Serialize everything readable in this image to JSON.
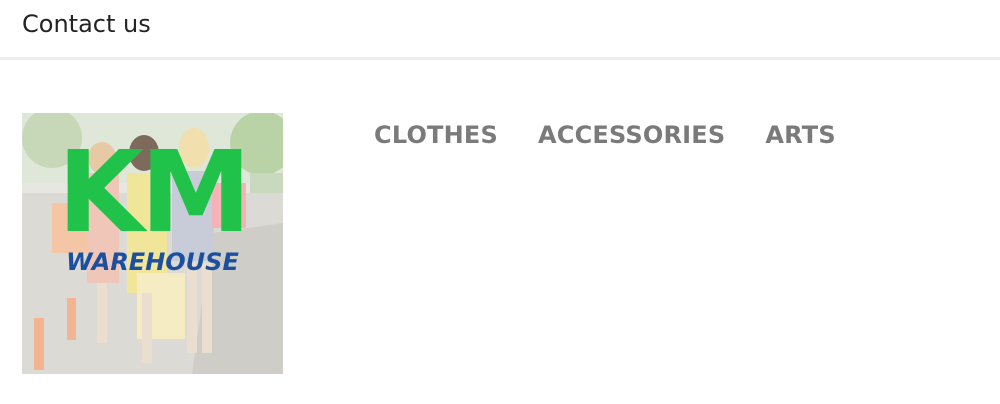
{
  "header": {
    "contact_label": "Contact us"
  },
  "logo": {
    "line1": "KM",
    "line2": "WAREHOUSE",
    "colors": {
      "km": "#21c24a",
      "warehouse": "#1c4f9e"
    }
  },
  "nav": {
    "items": [
      {
        "label": "CLOTHES"
      },
      {
        "label": "ACCESSORIES"
      },
      {
        "label": "ARTS"
      }
    ]
  },
  "colors": {
    "nav_text": "#7a7a7a",
    "header_text": "#232323",
    "divider": "#ededed"
  }
}
